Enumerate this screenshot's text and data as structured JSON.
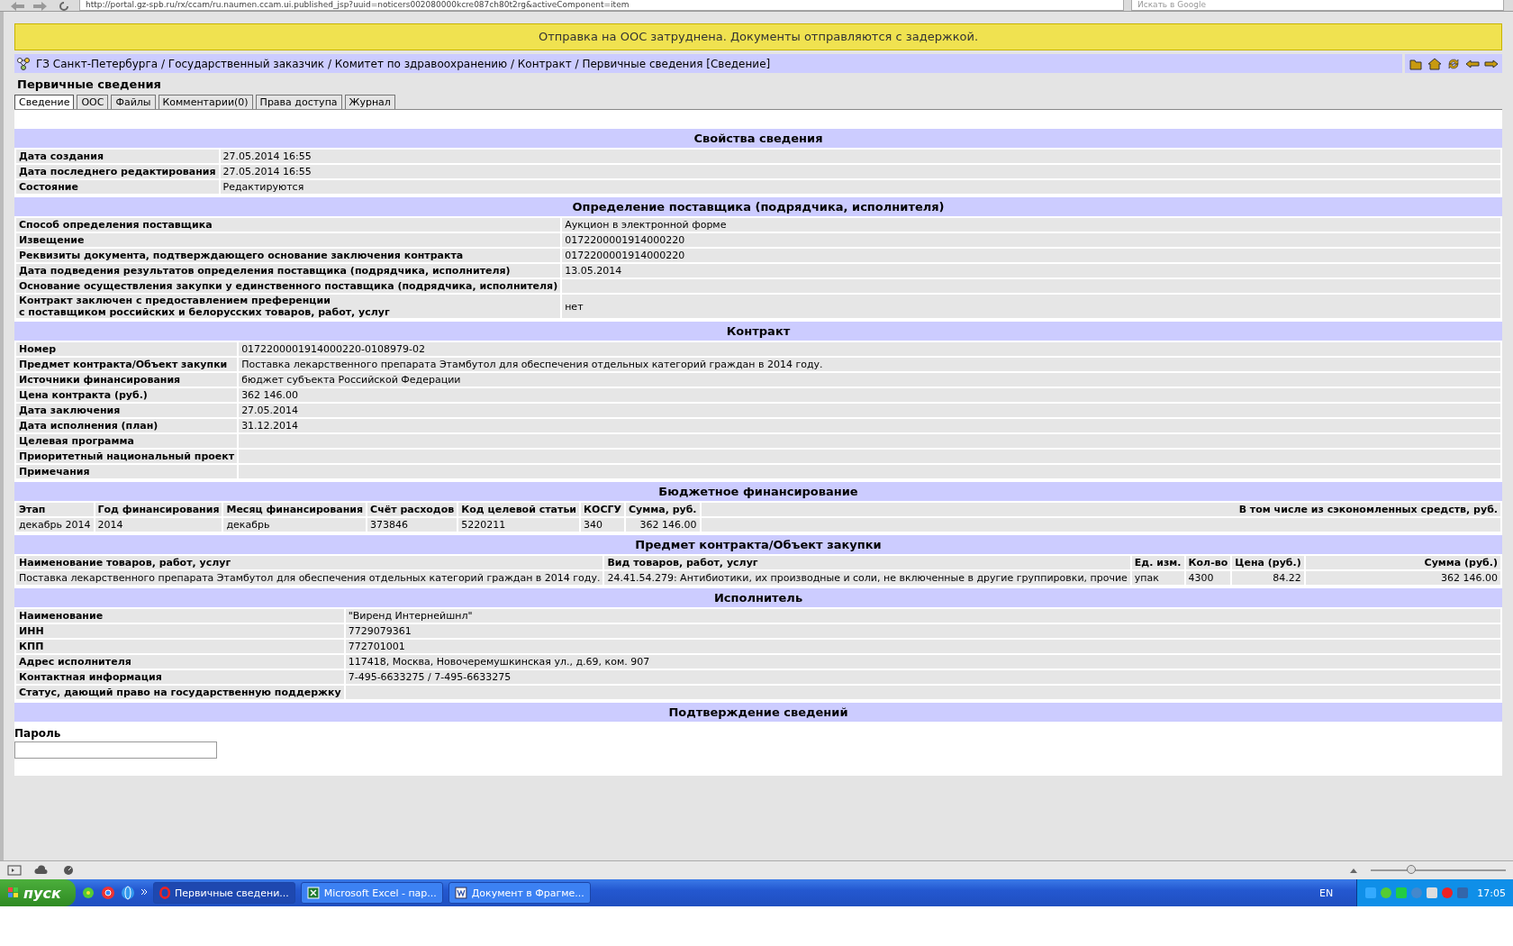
{
  "browser": {
    "url": "http://portal.gz-spb.ru/rx/ccam/ru.naumen.ccam.ui.published_jsp?uuid=noticers002080000kcre087ch80t2rg&activeComponent=item",
    "search_placeholder": "Искать в Google"
  },
  "banner": "Отправка на ООС затруднена. Документы отправляются с задержкой.",
  "breadcrumb": "ГЗ Санкт-Петербурга / Государственный заказчик / Комитет по здравоохранению / Контракт / Первичные сведения [Сведение]",
  "page_title": "Первичные сведения",
  "tabs": [
    {
      "label": "Сведение",
      "selected": true
    },
    {
      "label": "ООС",
      "selected": false
    },
    {
      "label": "Файлы",
      "selected": false
    },
    {
      "label": "Комментарии(0)",
      "selected": false
    },
    {
      "label": "Права доступа",
      "selected": false
    },
    {
      "label": "Журнал",
      "selected": false
    }
  ],
  "sections": [
    {
      "title": "Свойства сведения",
      "kind": "properties",
      "rows": [
        {
          "label": "Дата создания",
          "value": "27.05.2014 16:55"
        },
        {
          "label": "Дата последнего редактирования",
          "value": "27.05.2014 16:55"
        },
        {
          "label": "Состояние",
          "value": "Редактируются"
        }
      ]
    },
    {
      "title": "Определение поставщика (подрядчика, исполнителя)",
      "kind": "properties",
      "rows": [
        {
          "label": "Способ определения поставщика",
          "value": "Аукцион в электронной форме"
        },
        {
          "label": "Извещение",
          "value": "0172200001914000220"
        },
        {
          "label": "Реквизиты документа, подтверждающего основание заключения контракта",
          "value": "0172200001914000220"
        },
        {
          "label": "Дата подведения результатов определения поставщика (подрядчика, исполнителя)",
          "value": "13.05.2014"
        },
        {
          "label": "Основание осуществления закупки у единственного поставщика (подрядчика, исполнителя)"
        },
        {
          "label": "Контракт заключен с предоставлением преференции\nс поставщиком российских и белорусских товаров, работ, услуг",
          "value": "нет"
        }
      ]
    },
    {
      "title": "Контракт",
      "kind": "properties",
      "rows": [
        {
          "label": "Номер",
          "value": "0172200001914000220-0108979-02"
        },
        {
          "label": "Предмет контракта/Объект закупки",
          "value": "Поставка лекарственного препарата Этамбутол для обеспечения отдельных категорий граждан в 2014 году."
        },
        {
          "label": "Источники финансирования",
          "value": "бюджет субъекта Российской Федерации"
        },
        {
          "label": "Цена контракта (руб.)",
          "value": "362 146.00"
        },
        {
          "label": "Дата заключения",
          "value": "27.05.2014"
        },
        {
          "label": "Дата исполнения (план)",
          "value": "31.12.2014"
        },
        {
          "label": "Целевая программа"
        },
        {
          "label": "Приоритетный национальный проект"
        },
        {
          "label": "Примечания"
        }
      ]
    },
    {
      "title": "Бюджетное финансирование",
      "kind": "table",
      "columns": [
        {
          "label": "Этап",
          "numeric": false
        },
        {
          "label": "Год финансирования",
          "numeric": false
        },
        {
          "label": "Месяц финансирования",
          "numeric": false
        },
        {
          "label": "Счёт расходов",
          "numeric": false
        },
        {
          "label": "Код целевой статьи",
          "numeric": false
        },
        {
          "label": "КОСГУ",
          "numeric": false
        },
        {
          "label": "Сумма, руб.",
          "numeric": true
        },
        {
          "label": "В том числе из сэкономленных средств, руб.",
          "numeric": true
        }
      ],
      "rows": [
        [
          "декабрь 2014",
          "2014",
          "декабрь",
          "373846",
          "5220211",
          "340",
          "362 146.00",
          ""
        ]
      ]
    },
    {
      "title": "Предмет контракта/Объект закупки",
      "kind": "table",
      "columns": [
        {
          "label": "Наименование товаров, работ, услуг",
          "numeric": false
        },
        {
          "label": "Вид товаров, работ, услуг",
          "numeric": false
        },
        {
          "label": "Ед. изм.",
          "numeric": false
        },
        {
          "label": "Кол-во",
          "numeric": false
        },
        {
          "label": "Цена (руб.)",
          "numeric": true
        },
        {
          "label": "Сумма (руб.)",
          "numeric": true
        }
      ],
      "rows": [
        [
          "Поставка лекарственного препарата Этамбутол для обеспечения отдельных категорий граждан в 2014 году.",
          "24.41.54.279: Антибиотики, их производные и соли, не включенные в другие группировки, прочие",
          "упак",
          "4300",
          "84.22",
          "362 146.00"
        ]
      ]
    },
    {
      "title": "Исполнитель",
      "kind": "properties",
      "rows": [
        {
          "label": "Наименование",
          "value": "\"Виренд Интернейшнл\""
        },
        {
          "label": "ИНН",
          "value": "7729079361"
        },
        {
          "label": "КПП",
          "value": "772701001"
        },
        {
          "label": "Адрес исполнителя",
          "value": "117418, Москва, Новочеремушкинская ул., д.69, ком. 907"
        },
        {
          "label": "Контактная информация",
          "value": "7-495-6633275 / 7-495-6633275"
        },
        {
          "label": "Статус, дающий право на государственную поддержку"
        }
      ]
    },
    {
      "title": "Подтверждение сведений",
      "kind": "password",
      "label": "Пароль"
    }
  ],
  "zoom_slider": {
    "level": 0.3
  },
  "taskbar": {
    "start": "пуск",
    "tasks": [
      {
        "label": "Первичные сведени...",
        "kind": "opera",
        "selected": true
      },
      {
        "label": "Microsoft Excel - пар...",
        "kind": "excel",
        "selected": false
      },
      {
        "label": "Документ в Фрагме...",
        "kind": "word",
        "selected": false
      }
    ],
    "language": "EN",
    "clock": "17:05"
  }
}
